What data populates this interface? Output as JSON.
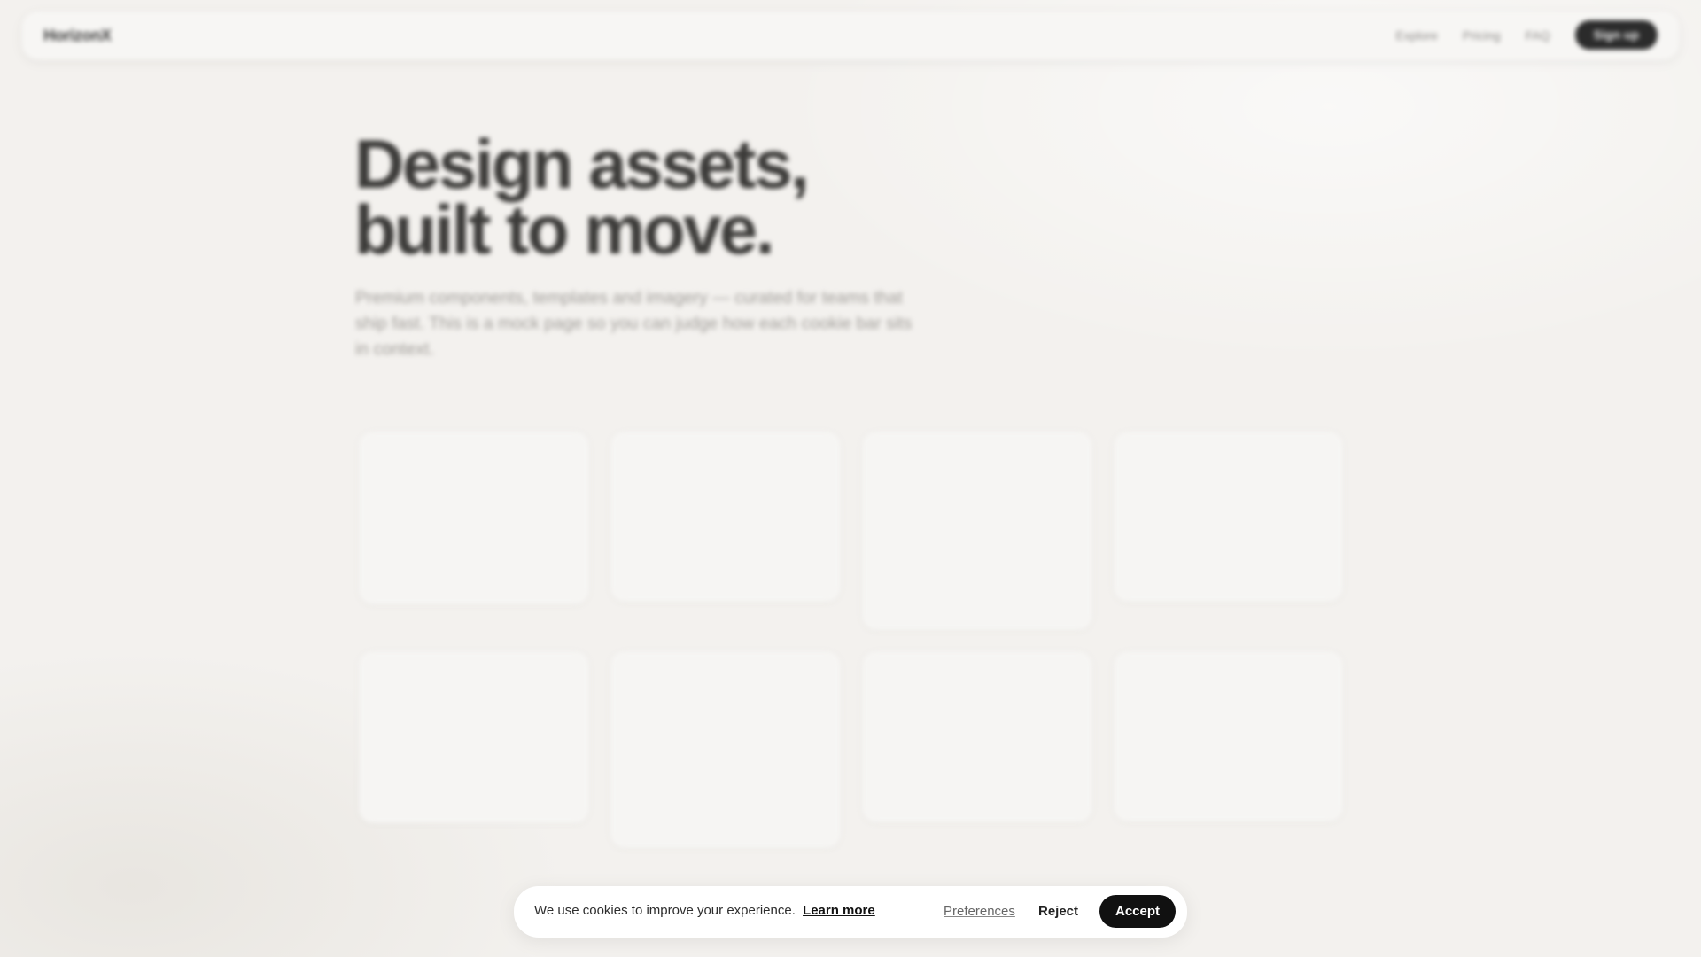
{
  "header": {
    "brand": "HorizonX",
    "nav": [
      "Explore",
      "Pricing",
      "FAQ"
    ],
    "signup_label": "Sign up"
  },
  "hero": {
    "title_line1": "Design assets,",
    "title_line2": "built to move.",
    "subtitle": "Premium components, templates and imagery — curated for teams that ship fast. This is a mock page so you can judge how each cookie bar sits in context."
  },
  "cookie_bar": {
    "message": "We use cookies to improve your experience.",
    "learn_more": "Learn more",
    "preferences": "Preferences",
    "reject": "Reject",
    "accept": "Accept"
  },
  "colors": {
    "background": "#f3f1ee",
    "accent": "#111111"
  }
}
